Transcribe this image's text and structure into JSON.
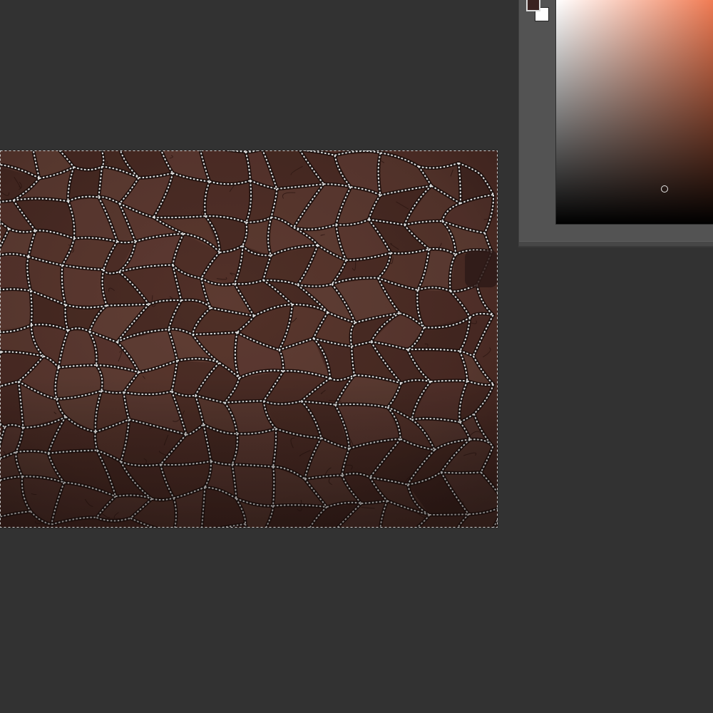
{
  "app": {
    "colors": {
      "workspace_background": "#323232",
      "panel_background": "#535353",
      "leather_base": "#4b2c25",
      "foreground_color": "#3a2220",
      "background_color": "#ffffff",
      "picker_hue": "#f07a52"
    }
  },
  "canvas": {
    "content": "leather-texture-with-marching-ants-selection"
  },
  "color_panel": {
    "foreground_swatch_icon": "foreground-color-swatch",
    "background_swatch_icon": "background-color-swatch",
    "picker_cursor_icon": "circle-cursor-icon"
  }
}
